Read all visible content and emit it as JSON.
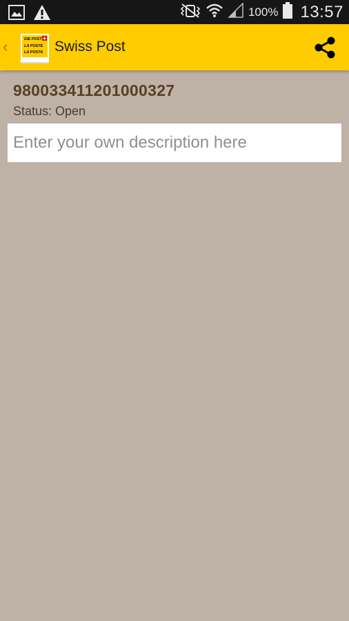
{
  "status_bar": {
    "icons": [
      "image-icon",
      "warning-icon",
      "vibrate-icon",
      "wifi-icon",
      "signal-icon",
      "battery-icon"
    ],
    "battery": "100%",
    "time": "13:57"
  },
  "action_bar": {
    "logo_lines": [
      "DIE POST",
      "LA POSTE",
      "LA POSTA"
    ],
    "title": "Swiss Post",
    "share_icon": "share-icon"
  },
  "shipment": {
    "tracking_number": "980033411201000327",
    "status": "Status: Open",
    "description_placeholder": "Enter your own description here",
    "description_value": ""
  },
  "colors": {
    "accent": "#ffcc00",
    "background": "#bdb2a5",
    "tracking_text": "#5a3f25"
  }
}
